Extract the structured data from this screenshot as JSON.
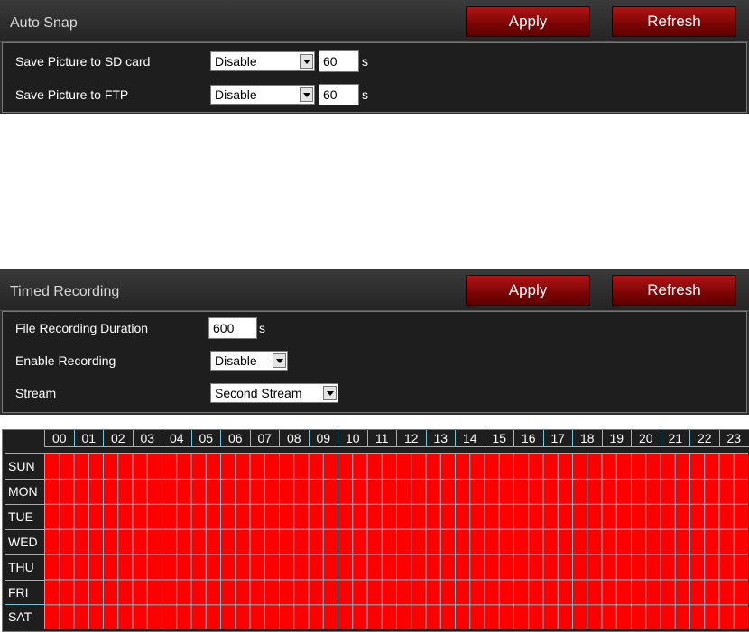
{
  "auto_snap": {
    "title": "Auto Snap",
    "apply_label": "Apply",
    "refresh_label": "Refresh",
    "rows": [
      {
        "label": "Save Picture to SD card",
        "select_value": "Disable",
        "interval": "60",
        "unit": "s"
      },
      {
        "label": "Save Picture to FTP",
        "select_value": "Disable",
        "interval": "60",
        "unit": "s"
      }
    ]
  },
  "timed_recording": {
    "title": "Timed Recording",
    "apply_label": "Apply",
    "refresh_label": "Refresh",
    "duration_label": "File Recording Duration",
    "duration_value": "600",
    "duration_unit": "s",
    "enable_label": "Enable Recording",
    "enable_value": "Disable",
    "stream_label": "Stream",
    "stream_value": "Second Stream"
  },
  "schedule": {
    "hours": [
      "00",
      "01",
      "02",
      "03",
      "04",
      "05",
      "06",
      "07",
      "08",
      "09",
      "10",
      "11",
      "12",
      "13",
      "14",
      "15",
      "16",
      "17",
      "18",
      "19",
      "20",
      "21",
      "22",
      "23"
    ],
    "days": [
      "SUN",
      "MON",
      "TUE",
      "WED",
      "THU",
      "FRI",
      "SAT"
    ],
    "cell_color": "#ff0000",
    "grid_color": "#6cc4dc",
    "all_slots_selected": true
  },
  "colors": {
    "button_red": "#8a0a0a",
    "panel_bg": "#2f2f2f"
  }
}
